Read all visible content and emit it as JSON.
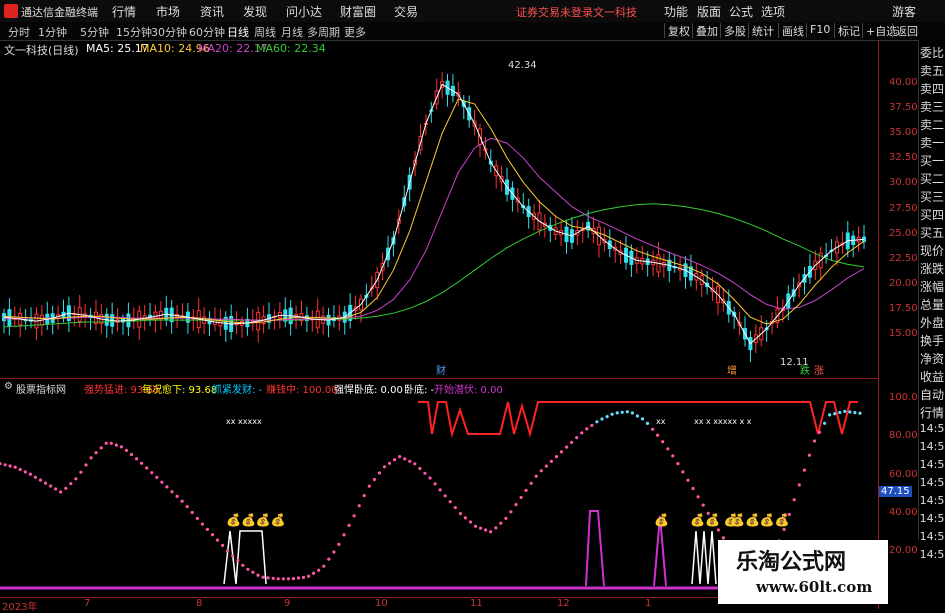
{
  "app": {
    "name": "通达信金融终端",
    "login_status": "证券交易未登录",
    "stock_label": "文一科技"
  },
  "menu": [
    "行情",
    "市场",
    "资讯",
    "发现",
    "问小达",
    "财富圈",
    "交易",
    "功能",
    "版面",
    "公式",
    "选项",
    "游客"
  ],
  "periods": [
    "分时",
    "1分钟",
    "5分钟",
    "15分钟",
    "30分钟",
    "60分钟",
    "日线",
    "周线",
    "月线",
    "多周期",
    "更多"
  ],
  "active_period": "日线",
  "right_tools": [
    "复权",
    "叠加",
    "多股",
    "统计",
    "画线",
    "F10",
    "标记",
    "+自选",
    "返回"
  ],
  "chart_title": "文一科技(日线)",
  "ma": [
    {
      "label": "MA5: 25.17",
      "color": "#ffffff"
    },
    {
      "label": "MA10: 24.96",
      "color": "#ffcc33"
    },
    {
      "label": "MA20: 22.17",
      "color": "#cc44cc"
    },
    {
      "label": "MA60: 22.34",
      "color": "#33cc33"
    }
  ],
  "price_axis": [
    "40.00",
    "37.50",
    "35.00",
    "32.50",
    "30.00",
    "27.50",
    "25.00",
    "22.50",
    "20.00",
    "17.50",
    "15.00"
  ],
  "annotations": {
    "high": "42.34",
    "low": "12.11",
    "cai": "财",
    "zeng": "增",
    "die": "跌",
    "zhang": "涨"
  },
  "indicator": {
    "name": "股票指标网",
    "items": [
      {
        "label": "强势猛进: 93.68",
        "color": "#ff3333"
      },
      {
        "label": "每况愈下: 93.68",
        "color": "#ffff00"
      },
      {
        "label": "抓紧发财: -",
        "color": "#00ccff"
      },
      {
        "label": "赚钱中: 100.00",
        "color": "#ff3333"
      },
      {
        "label": "强悍卧底: 0.00",
        "color": "#ffffff"
      },
      {
        "label": "卧底: -",
        "color": "#ffffff"
      },
      {
        "label": "开始潜伏: 0.00",
        "color": "#cc33cc"
      }
    ]
  },
  "indicator_axis": [
    "100.00",
    "80.00",
    "60.00",
    "40.00",
    "20.00"
  ],
  "indicator_current": "47.15",
  "sidebar": [
    "委比",
    "卖五",
    "卖四",
    "卖三",
    "卖二",
    "卖一",
    "买一",
    "买二",
    "买三",
    "买四",
    "买五",
    "现价",
    "涨跌",
    "涨幅",
    "总量",
    "外盘",
    "换手",
    "净资",
    "收益",
    "自动",
    "行情",
    "14:5",
    "14:5",
    "14:5",
    "14:5",
    "14:5",
    "14:5",
    "14:5",
    "14:5"
  ],
  "x_labels": [
    "2023年",
    "7",
    "8",
    "9",
    "10",
    "11",
    "12",
    "1"
  ],
  "watermark": {
    "title": "乐淘公式网",
    "url": "www.60lt.com"
  },
  "chart_data": {
    "type": "candlestick",
    "price_range": [
      12.0,
      43.5
    ],
    "ma5": [
      17.2,
      17.0,
      16.8,
      17.1,
      17.6,
      17.4,
      17.0,
      16.8,
      16.9,
      17.2,
      17.5,
      17.3,
      17.0,
      16.7,
      16.5,
      16.6,
      16.9,
      17.4,
      17.3,
      17.0,
      16.9,
      17.2,
      18.5,
      21.0,
      25.0,
      31.0,
      37.0,
      41.0,
      40.0,
      37.0,
      33.0,
      30.5,
      28.5,
      27.0,
      26.0,
      25.5,
      26.5,
      25.0,
      23.8,
      23.0,
      22.8,
      22.5,
      22.0,
      21.0,
      19.5,
      17.5,
      14.5,
      16.0,
      18.0,
      20.5,
      22.5,
      24.0,
      25.0,
      25.17
    ],
    "ma10": [
      17.3,
      17.2,
      17.1,
      17.0,
      17.2,
      17.3,
      17.3,
      17.1,
      17.0,
      17.0,
      17.1,
      17.2,
      17.1,
      16.9,
      16.7,
      16.6,
      16.7,
      17.0,
      17.2,
      17.2,
      17.1,
      17.1,
      17.7,
      19.2,
      22.0,
      26.0,
      31.0,
      36.0,
      39.5,
      39.0,
      36.5,
      33.5,
      31.0,
      29.0,
      27.5,
      26.5,
      26.2,
      25.6,
      24.8,
      24.0,
      23.4,
      22.9,
      22.4,
      21.7,
      20.6,
      19.0,
      17.2,
      16.5,
      17.0,
      18.5,
      20.5,
      22.3,
      23.8,
      24.96
    ],
    "ma20": [
      17.0,
      17.1,
      17.1,
      17.1,
      17.1,
      17.2,
      17.2,
      17.2,
      17.1,
      17.1,
      17.1,
      17.1,
      17.1,
      17.0,
      17.0,
      16.9,
      16.9,
      16.9,
      17.0,
      17.0,
      17.0,
      17.1,
      17.3,
      17.9,
      19.0,
      21.0,
      24.0,
      28.0,
      32.0,
      34.5,
      35.5,
      35.0,
      33.5,
      31.5,
      30.0,
      28.5,
      27.5,
      26.8,
      26.0,
      25.2,
      24.5,
      23.8,
      23.2,
      22.5,
      21.7,
      20.7,
      19.5,
      18.5,
      18.0,
      18.2,
      18.9,
      20.0,
      21.2,
      22.17
    ],
    "ma60": [
      16.2,
      16.3,
      16.4,
      16.5,
      16.6,
      16.7,
      16.7,
      16.8,
      16.8,
      16.9,
      16.9,
      16.9,
      16.9,
      16.9,
      16.9,
      16.9,
      16.9,
      16.9,
      16.9,
      17.0,
      17.0,
      17.0,
      17.1,
      17.3,
      17.6,
      18.1,
      18.8,
      19.7,
      20.8,
      22.0,
      23.2,
      24.3,
      25.2,
      26.0,
      26.7,
      27.3,
      27.8,
      28.2,
      28.5,
      28.7,
      28.8,
      28.7,
      28.5,
      28.2,
      27.8,
      27.3,
      26.7,
      26.0,
      25.2,
      24.5,
      23.7,
      23.0,
      22.6,
      22.34
    ],
    "indicator_dots": [
      68,
      66,
      62,
      57,
      52,
      60,
      72,
      80,
      77,
      70,
      62,
      54,
      46,
      36,
      27,
      18,
      10,
      5,
      4,
      4,
      5,
      10,
      22,
      38,
      55,
      66,
      72,
      68,
      60,
      50,
      40,
      33,
      30,
      38,
      50,
      62,
      70,
      78,
      86,
      92,
      96,
      97,
      92,
      82,
      70,
      56,
      42,
      28,
      16,
      10,
      12,
      30,
      55,
      80,
      95,
      97,
      96
    ]
  }
}
